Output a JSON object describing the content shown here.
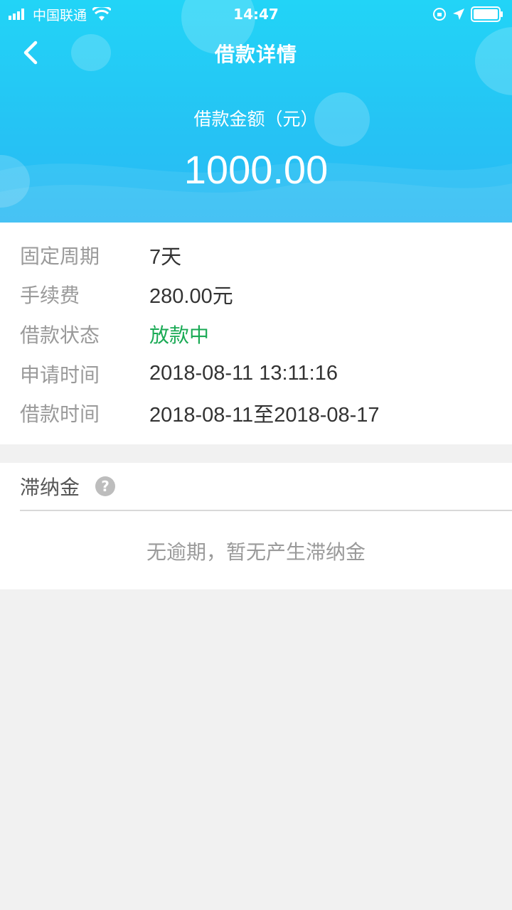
{
  "statusbar": {
    "carrier": "中国联通",
    "time": "14:47"
  },
  "nav": {
    "title": "借款详情"
  },
  "loan": {
    "amount_label": "借款金额（元）",
    "amount": "1000.00"
  },
  "details": [
    {
      "label": "固定周期",
      "value": "7天"
    },
    {
      "label": "手续费",
      "value": "280.00元"
    },
    {
      "label": "借款状态",
      "value": "放款中"
    },
    {
      "label": "申请时间",
      "value": "2018-08-11 13:11:16"
    },
    {
      "label": "借款时间",
      "value": "2018-08-11至2018-08-17"
    }
  ],
  "late_fee": {
    "title": "滞纳金",
    "help_glyph": "?",
    "empty_text": "无逾期，暂无产生滞纳金"
  },
  "colors": {
    "header_top": "#22d4f7",
    "header_bottom": "#2ab9f3",
    "status_green": "#1aaa55",
    "label_gray": "#9a9a9a",
    "background": "#f1f1f1"
  }
}
